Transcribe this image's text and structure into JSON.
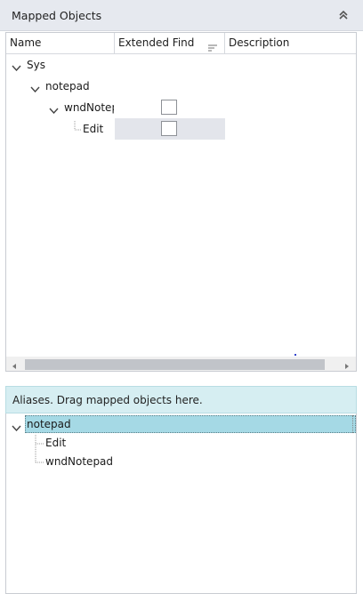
{
  "mapped_objects": {
    "title": "Mapped Objects",
    "columns": {
      "name": "Name",
      "extended_find": "Extended Find",
      "description": "Description"
    },
    "tree": {
      "sys": "Sys",
      "notepad": "notepad",
      "wnd_notepad": "wndNotep",
      "edit": "Edit"
    },
    "extended_find_checked": {
      "wnd_notepad": false,
      "edit": false
    }
  },
  "aliases": {
    "title": "Aliases. Drag mapped objects here.",
    "tree": {
      "notepad": "notepad",
      "edit": "Edit",
      "wnd_notepad": "wndNotepad"
    }
  },
  "colors": {
    "header_bg": "#e6e9ef",
    "selected_cell": "#e3e5eb",
    "alias_header_bg": "#d6eef2",
    "alias_selection": "#a5d9e5"
  },
  "icons": [
    "double-chevron-up-icon",
    "sort-icon",
    "chevron-down-icon",
    "scroll-left-icon",
    "scroll-right-icon",
    "checkbox"
  ]
}
